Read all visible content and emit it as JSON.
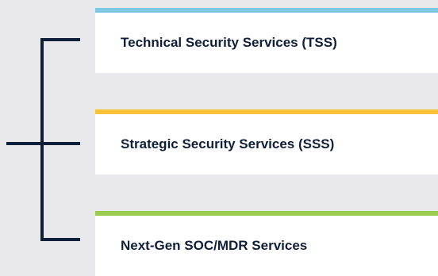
{
  "services": [
    {
      "label": "Technical Security Services (TSS)",
      "accent": "#7ec8e3"
    },
    {
      "label": "Strategic Security Services (SSS)",
      "accent": "#f7c23a"
    },
    {
      "label": "Next-Gen SOC/MDR Services",
      "accent": "#9bcc4f"
    }
  ],
  "colors": {
    "background": "#e9e9ec",
    "connector": "#0f1f3a",
    "text": "#0f1f3a",
    "card": "#ffffff"
  }
}
